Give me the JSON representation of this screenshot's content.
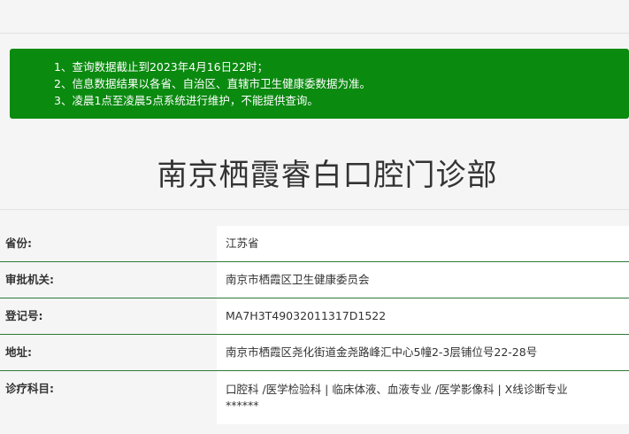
{
  "notice": {
    "lines": [
      "1、查询数据截止到2023年4月16日22时；",
      "2、信息数据结果以各省、自治区、直辖市卫生健康委数据为准。",
      "3、凌晨1点至凌晨5点系统进行维护，不能提供查询。"
    ],
    "bg_color": "#0b8a10"
  },
  "title": "南京栖霞睿白口腔门诊部",
  "info": {
    "province_label": "省份:",
    "province_value": "江苏省",
    "approval_label": "审批机关:",
    "approval_value": "南京市栖霞区卫生健康委员会",
    "reg_label": "登记号:",
    "reg_value": "MA7H3T49032011317D1522",
    "address_label": "地址:",
    "address_value": "南京市栖霞区尧化街道金尧路峰汇中心5幢2-3层铺位号22-28号",
    "dept_label": "诊疗科目:",
    "dept_line1": "口腔科 /医学检验科  |  临床体液、血液专业 /医学影像科  |  X线诊断专业",
    "dept_line2": "******"
  }
}
